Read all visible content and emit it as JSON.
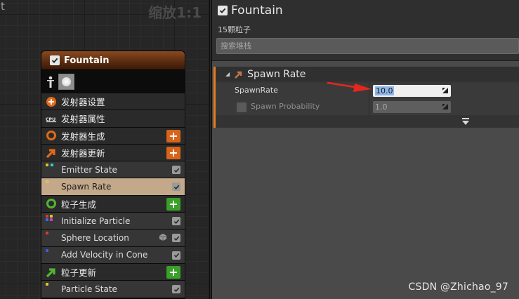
{
  "graph": {
    "title_stub": "t",
    "zoom_label": "缩放1:1"
  },
  "node": {
    "title": "Fountain",
    "enabled": true,
    "rows": [
      {
        "kind": "group",
        "label": "发射器设置",
        "icon": "emitter-settings-icon"
      },
      {
        "kind": "group",
        "label": "发射器属性",
        "icon": "cpu-icon"
      },
      {
        "kind": "group",
        "label": "发射器生成",
        "icon": "emitter-spawn-icon",
        "add": "orange"
      },
      {
        "kind": "group",
        "label": "发射器更新",
        "icon": "emitter-update-icon",
        "add": "orange"
      },
      {
        "kind": "module",
        "label": "Emitter State",
        "checked": true
      },
      {
        "kind": "module",
        "label": "Spawn Rate",
        "checked": true,
        "selected": true
      },
      {
        "kind": "group",
        "label": "粒子生成",
        "icon": "particle-spawn-icon",
        "add": "green"
      },
      {
        "kind": "module",
        "label": "Initialize Particle",
        "checked": true
      },
      {
        "kind": "module",
        "label": "Sphere Location",
        "checked": true
      },
      {
        "kind": "module",
        "label": "Add Velocity in Cone",
        "checked": true
      },
      {
        "kind": "group",
        "label": "粒子更新",
        "icon": "particle-update-icon",
        "add": "green"
      },
      {
        "kind": "module",
        "label": "Particle State",
        "checked": true
      }
    ]
  },
  "details": {
    "title": "Fountain",
    "count": "15颗粒子",
    "search_placeholder": "搜索堆栈",
    "section": {
      "title": "Spawn Rate",
      "props": [
        {
          "label": "SpawnRate",
          "value": "10.0"
        },
        {
          "label": "Spawn Probability",
          "value": "1.0"
        }
      ]
    }
  },
  "watermark": "CSDN @Zhichao_97",
  "colors": {
    "accent_orange": "#e57a1e",
    "add_orange": "#d8641a",
    "add_green": "#3aa02a",
    "selected_row": "#c3a88a",
    "annotation_red": "#e8261e"
  }
}
